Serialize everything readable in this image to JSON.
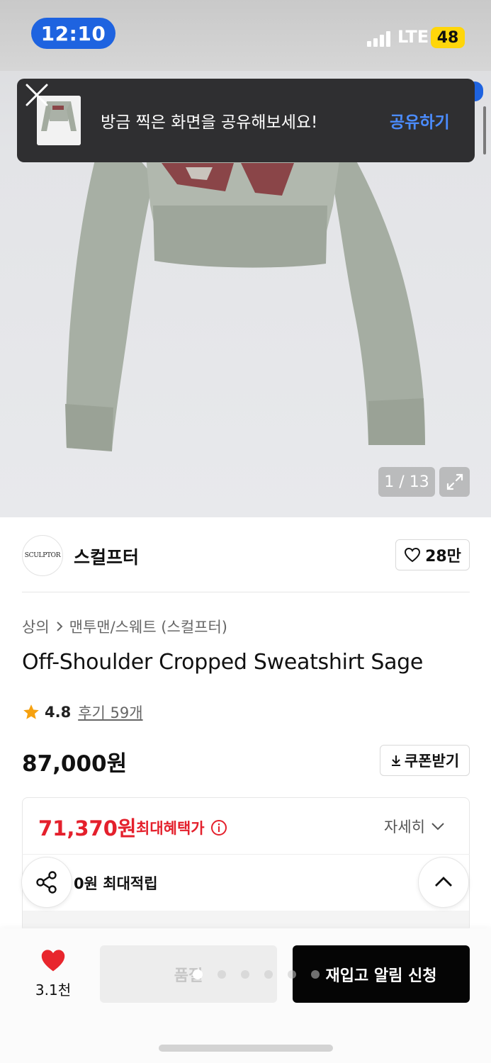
{
  "status_bar": {
    "time": "12:10",
    "network": "LTE",
    "battery": "48"
  },
  "toast": {
    "message": "방금 찍은 화면을 공유해보세요!",
    "action": "공유하기"
  },
  "gallery": {
    "pager": "1 / 13"
  },
  "brand": {
    "logo_text": "SCULPTOR",
    "name": "스컬프터",
    "likes": "28만"
  },
  "breadcrumb": {
    "category": "상의",
    "subcategory": "맨투맨/스웨트 (스컬프터)"
  },
  "product": {
    "title": "Off-Shoulder Cropped Sweatshirt Sage",
    "rating": "4.8",
    "reviews": "후기 59개",
    "price": "87,000원",
    "coupon_label": "쿠폰받기"
  },
  "benefit": {
    "price": "71,370원",
    "label": "최대혜택가",
    "detail": "자세히",
    "points": "0원 최대적립"
  },
  "bottom_bar": {
    "wish_count": "3.1천",
    "soldout_label": "품절",
    "restock_label": "재입고 알림 신청",
    "pagination_dots": 6,
    "active_dot": 1
  },
  "colors": {
    "accent_blue": "#1e63e0",
    "sale_red": "#e4202c",
    "heart_red": "#e8262d",
    "shirt_sage": "#a9b0a6",
    "print_maroon": "#8a4548"
  },
  "icons": [
    "close-icon",
    "heart-outline-icon",
    "chevron-right-icon",
    "star-icon",
    "download-icon",
    "info-icon",
    "chevron-down-icon",
    "share-icon",
    "chevron-up-icon",
    "heart-filled-icon",
    "expand-icon"
  ]
}
